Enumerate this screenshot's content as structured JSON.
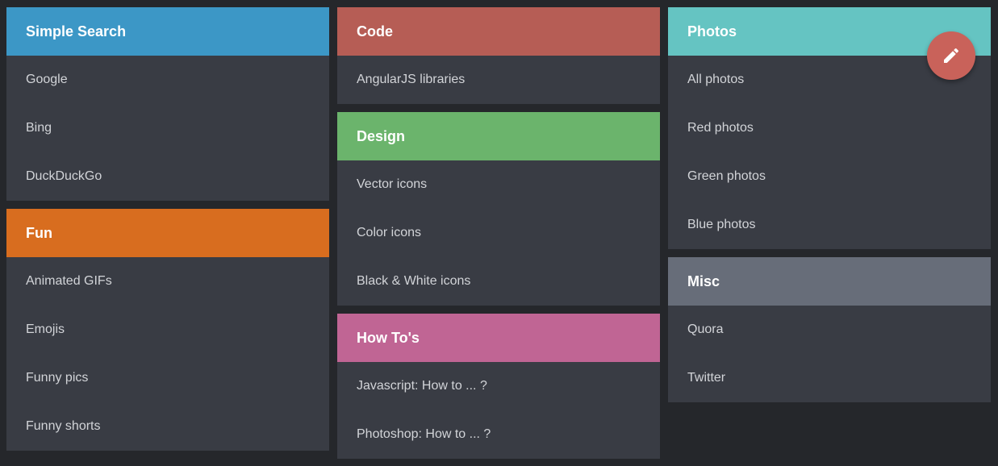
{
  "colors": {
    "background": "#25272b",
    "card_body": "#393c44",
    "item_text": "#d2d4d8",
    "fab": "#c9625a"
  },
  "columns": [
    {
      "cards": [
        {
          "title": "Simple Search",
          "color": "#3c97c6",
          "items": [
            "Google",
            "Bing",
            "DuckDuckGo"
          ]
        },
        {
          "title": "Fun",
          "color": "#d86d1f",
          "items": [
            "Animated GIFs",
            "Emojis",
            "Funny pics",
            "Funny shorts"
          ]
        }
      ]
    },
    {
      "cards": [
        {
          "title": "Code",
          "color": "#b65d55",
          "items": [
            "AngularJS libraries"
          ]
        },
        {
          "title": "Design",
          "color": "#6bb46c",
          "items": [
            "Vector icons",
            "Color icons",
            "Black & White icons"
          ]
        },
        {
          "title": "How To's",
          "color": "#c06594",
          "items": [
            "Javascript: How to ... ?",
            "Photoshop: How to ... ?"
          ]
        }
      ]
    },
    {
      "cards": [
        {
          "title": "Photos",
          "color": "#65c4c2",
          "items": [
            "All photos",
            "Red photos",
            "Green photos",
            "Blue photos"
          ]
        },
        {
          "title": "Misc",
          "color": "#676d79",
          "items": [
            "Quora",
            "Twitter"
          ]
        }
      ]
    }
  ],
  "fab": {
    "icon": "pencil-icon"
  }
}
